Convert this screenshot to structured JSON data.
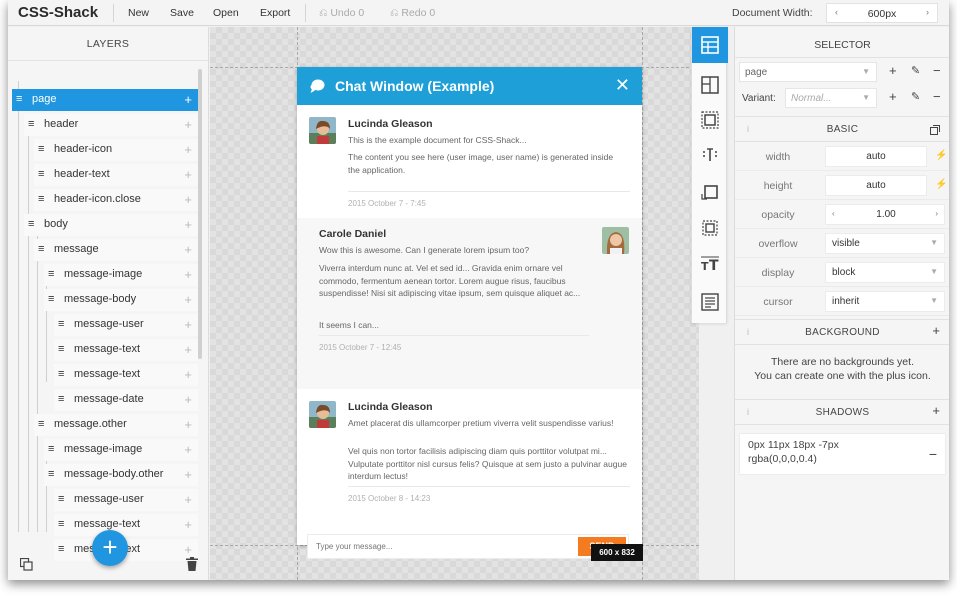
{
  "topbar": {
    "brand": "CSS-Shack",
    "menu": [
      "New",
      "Save",
      "Open",
      "Export"
    ],
    "undo": "Undo 0",
    "redo": "Redo 0",
    "doc_width_label": "Document Width:",
    "doc_width_value": "600px"
  },
  "layers": {
    "title": "LAYERS",
    "items": [
      {
        "label": "page",
        "depth": 0,
        "selected": true
      },
      {
        "label": "header",
        "depth": 1
      },
      {
        "label": "header-icon",
        "depth": 2
      },
      {
        "label": "header-text",
        "depth": 2
      },
      {
        "label": "header-icon.close",
        "depth": 2
      },
      {
        "label": "body",
        "depth": 1
      },
      {
        "label": "message",
        "depth": 2
      },
      {
        "label": "message-image",
        "depth": 3
      },
      {
        "label": "message-body",
        "depth": 3
      },
      {
        "label": "message-user",
        "depth": 4
      },
      {
        "label": "message-text",
        "depth": 4
      },
      {
        "label": "message-text",
        "depth": 4
      },
      {
        "label": "message-date",
        "depth": 4
      },
      {
        "label": "message.other",
        "depth": 2
      },
      {
        "label": "message-image",
        "depth": 3
      },
      {
        "label": "message-body.other",
        "depth": 3
      },
      {
        "label": "message-user",
        "depth": 4
      },
      {
        "label": "message-text",
        "depth": 4
      },
      {
        "label": "message-text",
        "depth": 4
      }
    ]
  },
  "chat": {
    "title": "Chat Window (Example)",
    "messages": [
      {
        "user": "Lucinda Gleason",
        "texts": [
          "This is the example document for CSS-Shack...",
          "The content you see here (user image, user name) is generated inside the application."
        ],
        "date": "2015 October 7 - 7:45"
      },
      {
        "user": "Carole Daniel",
        "texts": [
          "Wow this is awesome. Can I generate lorem ipsum too?",
          "Viverra interdum nunc at. Vel et sed id... Gravida enim ornare vel commodo, fermentum aenean tortor. Lorem augue risus, faucibus suspendisse! Nisi sit adipiscing vitae ipsum, sem quisque aliquet ac...",
          "It seems I can..."
        ],
        "date": "2015 October 7 - 12:45"
      },
      {
        "user": "Lucinda Gleason",
        "texts": [
          "Amet placerat dis ullamcorper pretium viverra velit suspendisse varius!",
          "Vel quis non tortor facilisis adipiscing diam quis porttitor volutpat mi... Vulputate porttitor nisl cursus felis? Quisque at sem justo a pulvinar augue interdum lectus!"
        ],
        "date": "2015 October 8 - 14:23"
      }
    ],
    "input_placeholder": "Type your message...",
    "send_label": "SEND",
    "size_badge": "600 x 832"
  },
  "selector": {
    "title": "SELECTOR",
    "value": "page",
    "variant_label": "Variant:",
    "variant_placeholder": "Normal..."
  },
  "basic": {
    "title": "BASIC",
    "rows": [
      {
        "label": "width",
        "value": "auto"
      },
      {
        "label": "height",
        "value": "auto"
      },
      {
        "label": "opacity",
        "value": "1.00"
      },
      {
        "label": "overflow",
        "value": "visible"
      },
      {
        "label": "display",
        "value": "block"
      },
      {
        "label": "cursor",
        "value": "inherit"
      }
    ]
  },
  "background": {
    "title": "BACKGROUND",
    "empty_line1": "There are no backgrounds yet.",
    "empty_line2": "You can create one with the plus icon."
  },
  "shadows": {
    "title": "SHADOWS",
    "value": "0px 11px 18px -7px rgba(0,0,0,0.4)"
  },
  "colors": {
    "accent": "#2196e0",
    "header": "#1e9fd8",
    "send": "#f47b20"
  },
  "icons": {
    "tools": [
      "layout-grid-icon",
      "split-pane-icon",
      "padding-box-icon",
      "text-cursor-icon",
      "border-box-icon",
      "margin-box-icon",
      "font-size-icon",
      "text-align-icon"
    ]
  }
}
